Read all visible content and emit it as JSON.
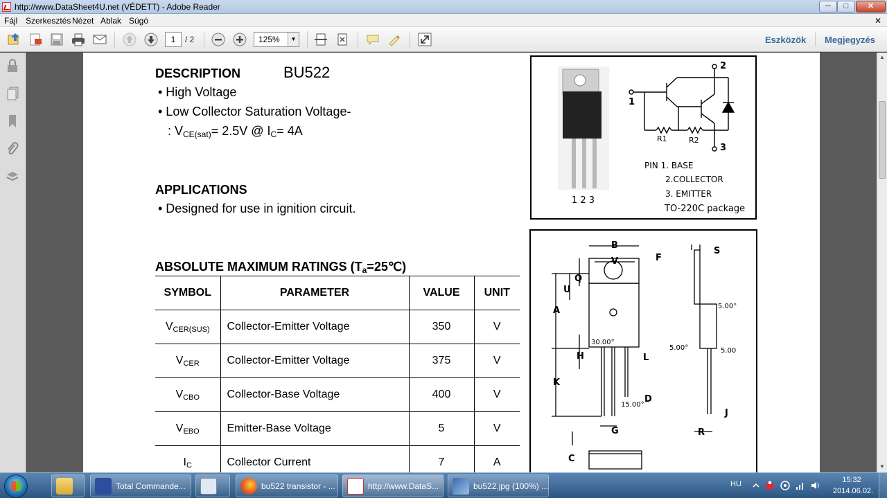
{
  "window": {
    "title": "http://www.DataSheet4U.net (VÉDETT) - Adobe Reader",
    "min_glyph": "─",
    "max_glyph": "□",
    "close_glyph": "✕"
  },
  "menu": {
    "items": [
      "Fájl",
      "Szerkesztés",
      "Nézet",
      "Ablak",
      "Súgó"
    ],
    "close_glyph": "✕"
  },
  "toolbar": {
    "page_current": "1",
    "page_total": "/ 2",
    "zoom": "125%",
    "zoom_arrow": "▼",
    "tools_label": "Eszközök",
    "comment_label": "Megjegyzés"
  },
  "scrollbar": {
    "up_glyph": "▲",
    "down_glyph": "▼"
  },
  "document": {
    "description_heading": "DESCRIPTION",
    "part_number": "BU522",
    "features": [
      "• High Voltage",
      "• Low Collector Saturation Voltage-"
    ],
    "vce_sat": {
      "prefix": ": V",
      "sub1": "CE(sat)",
      "mid": "= 2.5V @ I",
      "sub2": "C",
      "suffix": "= 4A"
    },
    "applications_heading": "APPLICATIONS",
    "applications": [
      "• Designed for use in ignition circuit."
    ],
    "ratings_heading_pre": "ABSOLUTE MAXIMUM RATINGS (T",
    "ratings_heading_sub": "a",
    "ratings_heading_post": "=25℃)",
    "ratings_table": {
      "headers": [
        "SYMBOL",
        "PARAMETER",
        "VALUE",
        "UNIT"
      ],
      "rows": [
        {
          "sym": "V",
          "sub": "CER(SUS)",
          "param": "Collector-Emitter Voltage",
          "value": "350",
          "unit": "V"
        },
        {
          "sym": "V",
          "sub": "CER",
          "param": "Collector-Emitter Voltage",
          "value": "375",
          "unit": "V"
        },
        {
          "sym": "V",
          "sub": "CBO",
          "param": "Collector-Base Voltage",
          "value": "400",
          "unit": "V"
        },
        {
          "sym": "V",
          "sub": "EBO",
          "param": "Emitter-Base Voltage",
          "value": "5",
          "unit": "V"
        },
        {
          "sym": "I",
          "sub": "C",
          "param": "Collector Current",
          "value": "7",
          "unit": "A"
        }
      ]
    },
    "pin_diagram": {
      "pin_numbers_photo": "1  2  3",
      "node1": "1",
      "node2": "2",
      "node3": "3",
      "r1": "R1",
      "r2": "R2",
      "pin_line1": "PIN  1. BASE",
      "pin_line2": "2.COLLECTOR",
      "pin_line3": "3. EMITTER",
      "package": "TO-220C package"
    },
    "dimension_diagram": {
      "labels": [
        "B",
        "V",
        "F",
        "S",
        "Q",
        "U",
        "A",
        "5.00°",
        "5.00°",
        "5.00",
        "30.00°",
        "H",
        "L",
        "K",
        "15.00°",
        "D",
        "J",
        "G",
        "R",
        "C"
      ]
    }
  },
  "taskbar": {
    "tasks": [
      {
        "label": ""
      },
      {
        "label": "Total Commande..."
      },
      {
        "label": ""
      },
      {
        "label": "bu522 transistor - ..."
      },
      {
        "label": "http://www.DataS..."
      },
      {
        "label": "bu522.jpg (100%) ..."
      }
    ],
    "lang": "HU",
    "time": "15:32",
    "date": "2014.06.02."
  }
}
